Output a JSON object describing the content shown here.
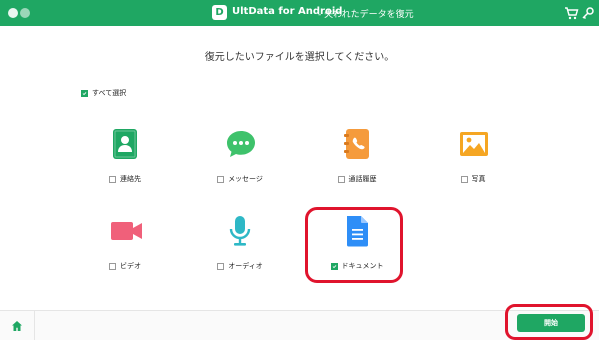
{
  "window": {
    "title": "UltData for Android",
    "subtitle": "- 失われたデータを復元",
    "logo_letter": "D"
  },
  "colors": {
    "accent": "#1fa763",
    "highlight": "#e0142d"
  },
  "heading": "復元したいファイルを選択してください。",
  "select_all": {
    "label": "すべて選択",
    "checked": true
  },
  "items": [
    {
      "label": "連絡先",
      "icon": "contacts-icon",
      "checked": false
    },
    {
      "label": "メッセージ",
      "icon": "messages-icon",
      "checked": false
    },
    {
      "label": "通話履歴",
      "icon": "call-history-icon",
      "checked": false
    },
    {
      "label": "写真",
      "icon": "photos-icon",
      "checked": false
    },
    {
      "label": "ビデオ",
      "icon": "video-icon",
      "checked": false
    },
    {
      "label": "オーディオ",
      "icon": "audio-icon",
      "checked": false
    },
    {
      "label": "ドキュメント",
      "icon": "document-icon",
      "checked": true
    }
  ],
  "footer": {
    "start_label": "開始",
    "home_icon": "home-icon"
  }
}
